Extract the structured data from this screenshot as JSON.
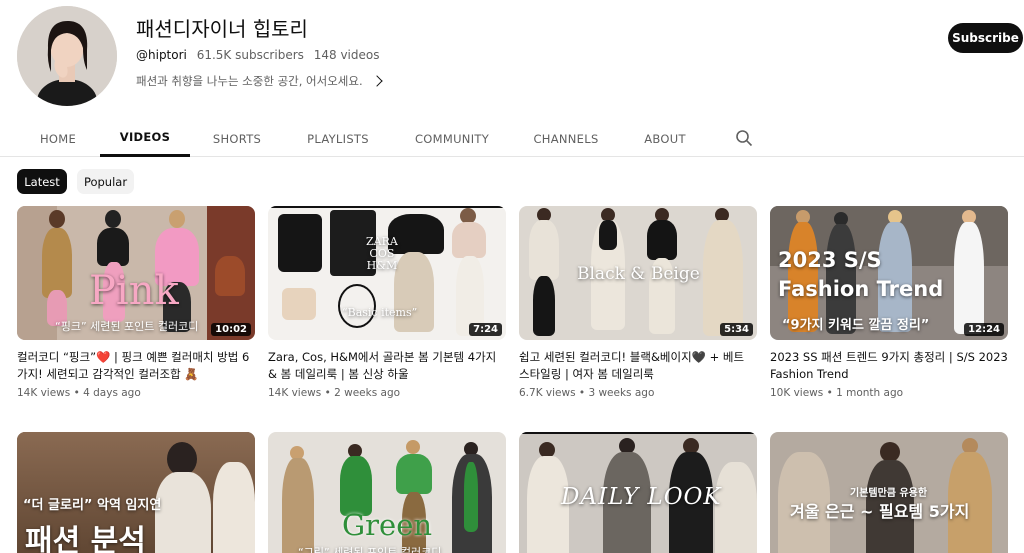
{
  "channel": {
    "name": "패션디자이너 힙토리",
    "handle": "@hiptori",
    "subscribers": "61.5K subscribers",
    "videos_count": "148 videos",
    "description": "패션과 취향을 나누는 소중한 공간, 어서오세요."
  },
  "subscribe_label": "Subscribe",
  "tabs": [
    {
      "label": "HOME"
    },
    {
      "label": "VIDEOS"
    },
    {
      "label": "SHORTS"
    },
    {
      "label": "PLAYLISTS"
    },
    {
      "label": "COMMUNITY"
    },
    {
      "label": "CHANNELS"
    },
    {
      "label": "ABOUT"
    }
  ],
  "active_tab": "VIDEOS",
  "chips": [
    {
      "label": "Latest"
    },
    {
      "label": "Popular"
    }
  ],
  "videos": [
    {
      "title": "컬러코디 “핑크”❤️ | 핑크 예쁜 컬러매치 방법 6가지! 세련되고 감각적인 컬러조합 🧸",
      "views": "14K views",
      "age": "4 days ago",
      "duration": "10:02",
      "overlay_main": "Pink",
      "overlay_sub": "“핑크” 세련된 포인트 컬러코디"
    },
    {
      "title": "Zara, Cos, H&M에서 골라본 봄 기본템 4가지 & 봄 데일리룩 | 봄 신상 하울",
      "views": "14K views",
      "age": "2 weeks ago",
      "duration": "7:24",
      "overlay_main": "ZARA\nCOS\nH&M",
      "overlay_sub": "“Basic items”"
    },
    {
      "title": "쉽고 세련된 컬러코디! 블랙&베이지🖤 + 베트 스타일링 | 여자 봄 데일리룩",
      "views": "6.7K views",
      "age": "3 weeks ago",
      "duration": "5:34",
      "overlay_main": "Black & Beige",
      "overlay_sub": ""
    },
    {
      "title": "2023 SS 패션 트렌드 9가지 총정리 | S/S 2023 Fashion Trend",
      "views": "10K views",
      "age": "1 month ago",
      "duration": "12:24",
      "overlay_main": "2023 S/S\nFashion Trend",
      "overlay_sub": "“9가지 키워드 깔끔 정리”"
    },
    {
      "title": "",
      "views": "",
      "age": "",
      "duration": "",
      "overlay_main": "패션 분석",
      "overlay_sub": "“더 글로리” 악역 임지연"
    },
    {
      "title": "",
      "views": "",
      "age": "",
      "duration": "",
      "overlay_main": "Green",
      "overlay_sub": "“그린” 세련된 포인트 컬러코디"
    },
    {
      "title": "",
      "views": "",
      "age": "",
      "duration": "",
      "overlay_main": "DAILY LOOK",
      "overlay_sub": ""
    },
    {
      "title": "",
      "views": "",
      "age": "",
      "duration": "",
      "overlay_main": "겨울 은근 ~ 필요템 5가지",
      "overlay_sub": "기본템만큼 유용한"
    }
  ],
  "colors": {
    "accent": "#0f0f0f",
    "muted_text": "#606060",
    "chip_bg": "#f2f2f2",
    "pink_overlay": "#f7a8c4",
    "green_overlay": "#2f8f3a"
  },
  "icons": {
    "search": "search-icon",
    "chevron": "chevron-right-icon"
  }
}
